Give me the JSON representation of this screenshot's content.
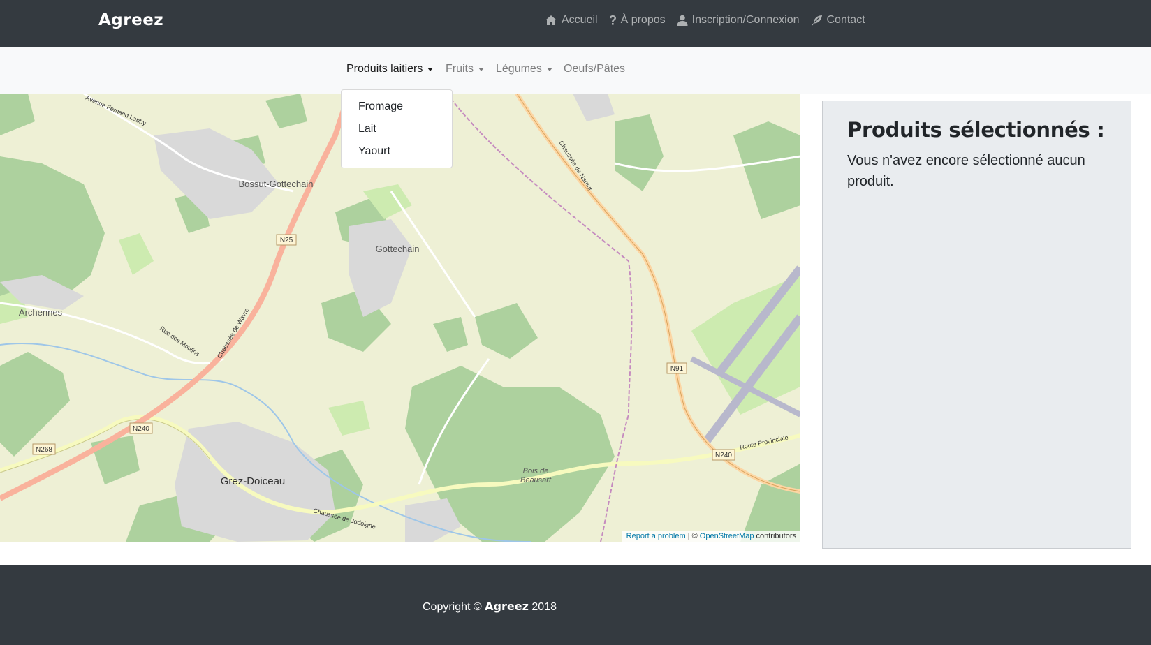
{
  "navbar": {
    "brand": "Agreez",
    "items": [
      {
        "label": "Accueil",
        "icon": "home-icon"
      },
      {
        "label": "À propos",
        "icon": "question-icon"
      },
      {
        "label": "Inscription/Connexion",
        "icon": "user-icon"
      },
      {
        "label": "Contact",
        "icon": "feather-icon"
      }
    ]
  },
  "categories": [
    {
      "label": "Produits laitiers",
      "dropdown": true,
      "active": true
    },
    {
      "label": "Fruits",
      "dropdown": true
    },
    {
      "label": "Légumes",
      "dropdown": true
    },
    {
      "label": "Oeufs/Pâtes",
      "dropdown": false
    }
  ],
  "dropdown": {
    "items": [
      "Fromage",
      "Lait",
      "Yaourt"
    ]
  },
  "map": {
    "places": [
      "Bossut-Gottechain",
      "Gottechain",
      "Archennes",
      "Grez-Doiceau",
      "Bois de",
      "Beausart"
    ],
    "roads": [
      "Avenue Fernand Labby",
      "Chaussée de Namur",
      "Chaussée de Wavre",
      "Rue des Moulins",
      "Chaussée de Jodoigne",
      "Route Provinciale"
    ],
    "shields": [
      "N25",
      "N91",
      "N240",
      "N268",
      "N240"
    ],
    "attribution": {
      "report": "Report a problem",
      "sep": "| ©",
      "link": "OpenStreetMap",
      "suffix": "contributors"
    }
  },
  "panel": {
    "title": "Produits sélectionnés :",
    "text": "Vous n'avez encore sélectionné aucun produit."
  },
  "footer": {
    "prefix": "Copyright ©",
    "brand": "Agreez",
    "year": "2018"
  },
  "colors": {
    "dark": "#343a40",
    "light": "#f8f9fa",
    "panel": "#e9ecef",
    "forest": "#add19e",
    "farmland": "#eef0d5",
    "urban": "#d9d9d9",
    "primary_road": "#fcd6a4",
    "trunk_road": "#f9b29c",
    "link": "#0078a8"
  }
}
